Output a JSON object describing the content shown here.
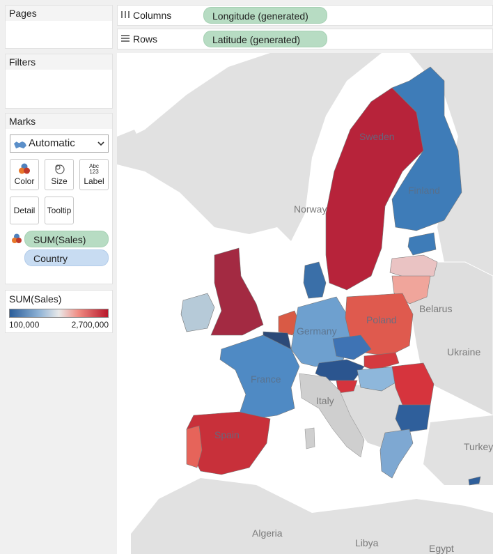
{
  "sidebar": {
    "pages_title": "Pages",
    "filters_title": "Filters",
    "marks_title": "Marks",
    "mark_type": "Automatic",
    "buttons": {
      "color": "Color",
      "size": "Size",
      "label": "Label",
      "detail": "Detail",
      "tooltip": "Tooltip"
    },
    "label_icon_text": "Abc\n123",
    "fields": {
      "sales": "SUM(Sales)",
      "country": "Country"
    },
    "legend": {
      "title": "SUM(Sales)",
      "min": "100,000",
      "max": "2,700,000",
      "colors": [
        "#2a5d99",
        "#8fb3d6",
        "#e9e9e9",
        "#f08b82",
        "#b8182b"
      ]
    }
  },
  "shelves": {
    "columns_label": "Columns",
    "columns_pill": "Longitude (generated)",
    "rows_label": "Rows",
    "rows_pill": "Latitude (generated)"
  },
  "map": {
    "labels": {
      "sweden": "Sweden",
      "finland": "Finland",
      "norway": "Norway",
      "belarus": "Belarus",
      "poland": "Poland",
      "germany": "Germany",
      "ukraine": "Ukraine",
      "france": "France",
      "italy": "Italy",
      "spain": "Spain",
      "turkey": "Turkey",
      "algeria": "Algeria",
      "libya": "Libya",
      "egypt": "Egypt"
    }
  }
}
